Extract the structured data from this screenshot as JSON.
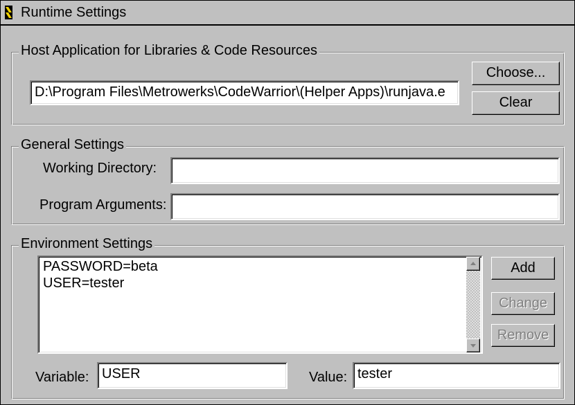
{
  "window": {
    "title": "Runtime Settings"
  },
  "host_app": {
    "group_label": "Host Application for Libraries & Code Resources",
    "path_value": "D:\\Program Files\\Metrowerks\\CodeWarrior\\(Helper Apps)\\runjava.e",
    "choose_label": "Choose...",
    "clear_label": "Clear"
  },
  "general": {
    "group_label": "General Settings",
    "working_dir_label": "Working Directory:",
    "working_dir_value": "",
    "program_args_label": "Program Arguments:",
    "program_args_value": ""
  },
  "environment": {
    "group_label": "Environment Settings",
    "items": [
      "PASSWORD=beta",
      "USER=tester"
    ],
    "add_label": "Add",
    "change_label": "Change",
    "remove_label": "Remove",
    "variable_label": "Variable:",
    "variable_value": "USER",
    "value_label": "Value:",
    "value_value": "tester"
  },
  "icons": {
    "title": "codewarrior-app-icon",
    "scroll_up": "arrow-up-icon",
    "scroll_down": "arrow-down-icon"
  },
  "colors": {
    "face": "#c0c0c0",
    "shadow": "#808080",
    "highlight": "#ffffff",
    "disabled_text": "#808080"
  }
}
